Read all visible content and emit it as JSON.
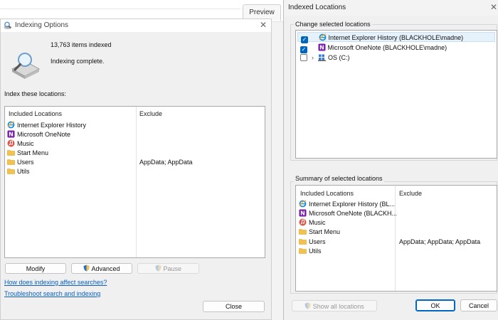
{
  "background": {
    "tab_label": "Preview"
  },
  "indexing_options": {
    "title": "Indexing Options",
    "items_indexed": "13,763 items indexed",
    "status": "Indexing complete.",
    "section_label": "Index these locations:",
    "headers": {
      "included": "Included Locations",
      "exclude": "Exclude"
    },
    "rows": [
      {
        "name": "Internet Explorer History",
        "exclude": "",
        "icon": "ie-icon"
      },
      {
        "name": "Microsoft OneNote",
        "exclude": "",
        "icon": "onenote-icon"
      },
      {
        "name": "Music",
        "exclude": "",
        "icon": "music-icon"
      },
      {
        "name": "Start Menu",
        "exclude": "",
        "icon": "folder-icon"
      },
      {
        "name": "Users",
        "exclude": "AppData; AppData",
        "icon": "folder-icon"
      },
      {
        "name": "Utils",
        "exclude": "",
        "icon": "folder-icon"
      }
    ],
    "buttons": {
      "modify": "Modify",
      "advanced": "Advanced",
      "pause": "Pause",
      "close": "Close"
    },
    "links": {
      "how": "How does indexing affect searches?",
      "troubleshoot": "Troubleshoot search and indexing"
    }
  },
  "indexed_locations": {
    "title": "Indexed Locations",
    "change_label": "Change selected locations",
    "tree": [
      {
        "label": "Internet Explorer History (BLACKHOLE\\madne)",
        "checked": true,
        "icon": "ie-icon"
      },
      {
        "label": "Microsoft OneNote (BLACKHOLE\\madne)",
        "checked": true,
        "icon": "onenote-icon"
      },
      {
        "label": "OS (C:)",
        "checked": false,
        "icon": "drive-icon"
      }
    ],
    "summary_label": "Summary of selected locations",
    "headers": {
      "included": "Included Locations",
      "exclude": "Exclude"
    },
    "summary_rows": [
      {
        "name": "Internet Explorer History (BL...",
        "exclude": "",
        "icon": "ie-icon"
      },
      {
        "name": "Microsoft OneNote (BLACKH...",
        "exclude": "",
        "icon": "onenote-icon"
      },
      {
        "name": "Music",
        "exclude": "",
        "icon": "music-icon"
      },
      {
        "name": "Start Menu",
        "exclude": "",
        "icon": "folder-icon"
      },
      {
        "name": "Users",
        "exclude": "AppData; AppData; AppData",
        "icon": "folder-icon"
      },
      {
        "name": "Utils",
        "exclude": "",
        "icon": "folder-icon"
      }
    ],
    "buttons": {
      "show_all": "Show all locations",
      "ok": "OK",
      "cancel": "Cancel"
    }
  },
  "colors": {
    "accent": "#0067c0",
    "link": "#0a5fbf",
    "folder": "#f2c14e",
    "onenote": "#7719aa",
    "music": "#e0564a"
  }
}
